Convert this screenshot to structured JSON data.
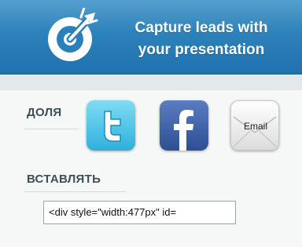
{
  "banner": {
    "line1": "Capture leads with",
    "line2": "your presentation",
    "logo_icon": "target-arrow-icon",
    "color_top": "#3a8fc6",
    "color_bottom": "#1f72ad"
  },
  "share": {
    "label": "ДОЛЯ",
    "buttons": [
      {
        "name": "twitter",
        "icon": "twitter-icon",
        "color": "#55c7e8"
      },
      {
        "name": "facebook",
        "icon": "facebook-icon",
        "color": "#3b5998"
      },
      {
        "name": "email",
        "icon": "email-icon",
        "label": "Email"
      }
    ]
  },
  "embed": {
    "label": "ВСТАВЛЯТЬ",
    "code": "<div style=\"width:477px\" id="
  }
}
